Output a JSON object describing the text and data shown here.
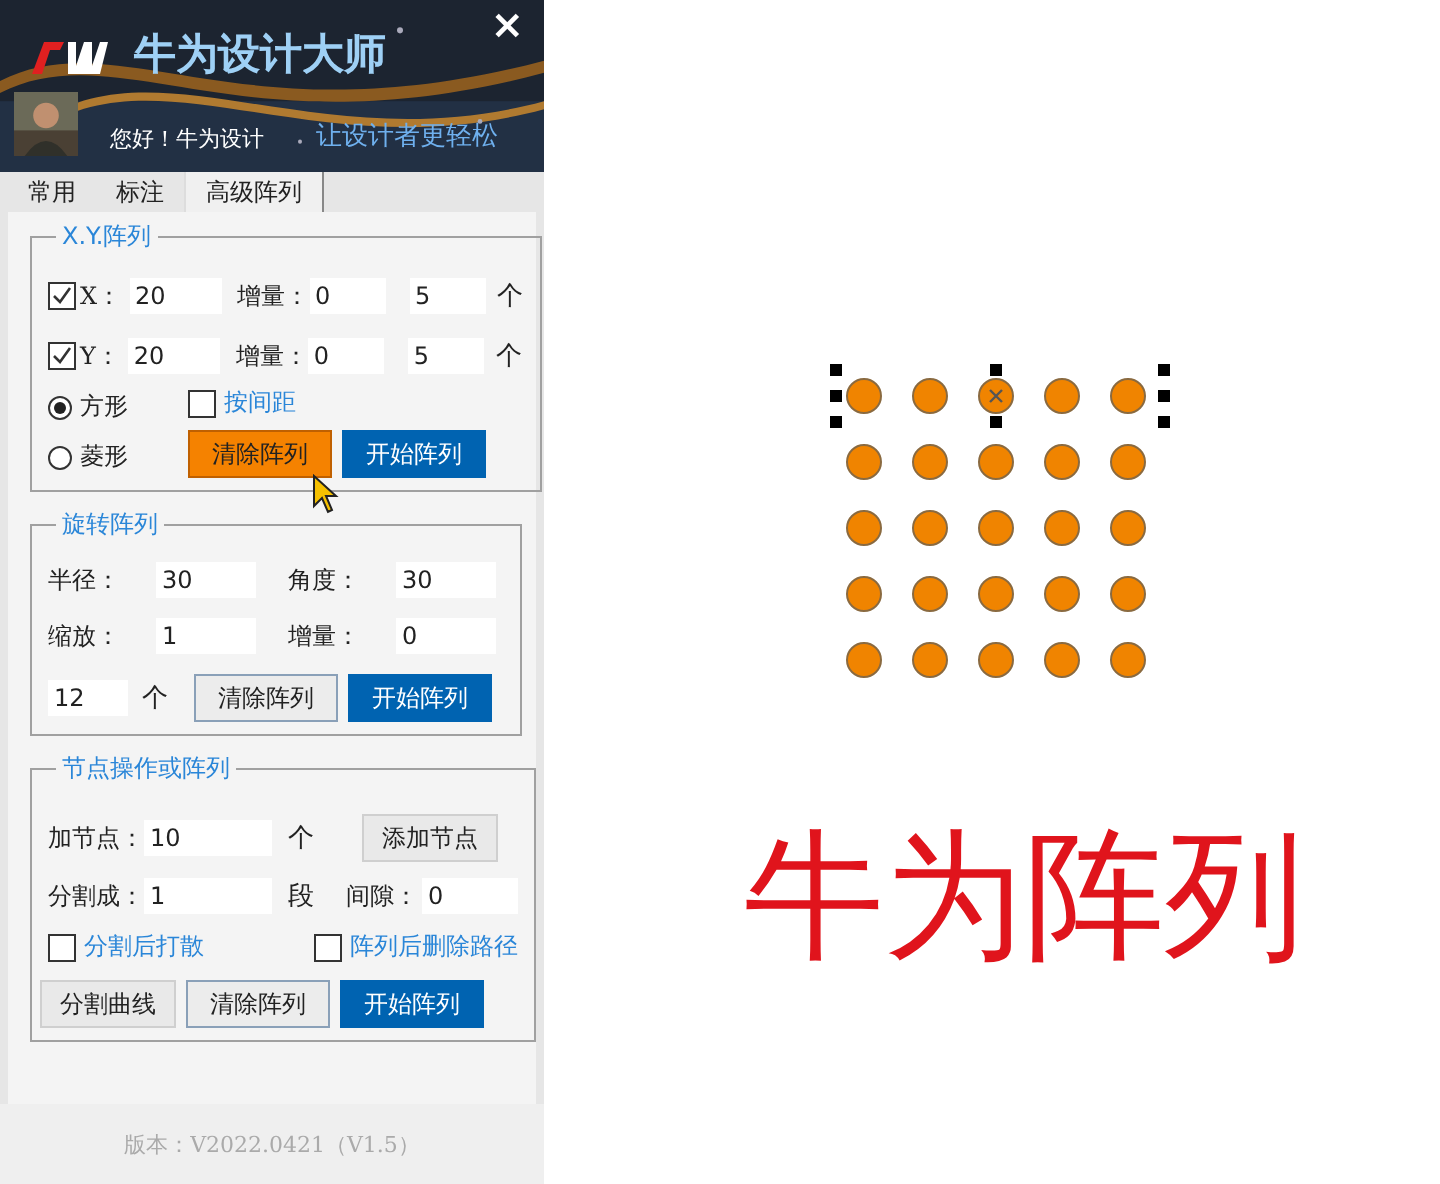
{
  "header": {
    "title": "牛为设计大师",
    "greeting": "您好！牛为设计",
    "slogan": "让设计者更轻松",
    "close": "×"
  },
  "tabs": [
    {
      "label": "常用",
      "selected": false
    },
    {
      "label": "标注",
      "selected": false
    },
    {
      "label": "高级阵列",
      "selected": true
    }
  ],
  "xy_array": {
    "title": "X.Y.阵列",
    "rows": [
      {
        "checked": true,
        "label": "X：",
        "value": "20",
        "increment_label": "增量：",
        "increment": "0",
        "count": "5",
        "unit": "个"
      },
      {
        "checked": true,
        "label": "Y：",
        "value": "20",
        "increment_label": "增量：",
        "increment": "0",
        "count": "5",
        "unit": "个"
      }
    ],
    "shapes": [
      {
        "label": "方形",
        "selected": true
      },
      {
        "label": "菱形",
        "selected": false
      }
    ],
    "spacing": {
      "label": "按间距",
      "checked": false
    },
    "buttons": [
      {
        "label": "清除阵列",
        "kind": "highlight"
      },
      {
        "label": "开始阵列",
        "kind": "primary"
      }
    ]
  },
  "rotate_array": {
    "title": "旋转阵列",
    "fields": [
      {
        "label": "半径：",
        "value": "30"
      },
      {
        "label": "角度：",
        "value": "30"
      },
      {
        "label": "缩放：",
        "value": "1"
      },
      {
        "label": "增量：",
        "value": "0"
      }
    ],
    "count": "12",
    "unit": "个",
    "buttons": [
      {
        "label": "清除阵列",
        "kind": "outline"
      },
      {
        "label": "开始阵列",
        "kind": "primary"
      }
    ]
  },
  "node_array": {
    "title": "节点操作或阵列",
    "add_label": "加节点：",
    "add_value": "10",
    "add_unit": "个",
    "add_button": "添加节点",
    "split_label": "分割成：",
    "split_value": "1",
    "split_unit": "段",
    "gap_label": "间隙：",
    "gap_value": "0",
    "checkboxes": [
      {
        "label": "分割后打散",
        "checked": false
      },
      {
        "label": "阵列后删除路径",
        "checked": false
      }
    ],
    "buttons": [
      {
        "label": "分割曲线",
        "kind": "plain"
      },
      {
        "label": "清除阵列",
        "kind": "outline"
      },
      {
        "label": "开始阵列",
        "kind": "primary"
      }
    ]
  },
  "version": "版本：V2022.0421（V1.5）",
  "canvas": {
    "caption": "牛为阵列"
  }
}
